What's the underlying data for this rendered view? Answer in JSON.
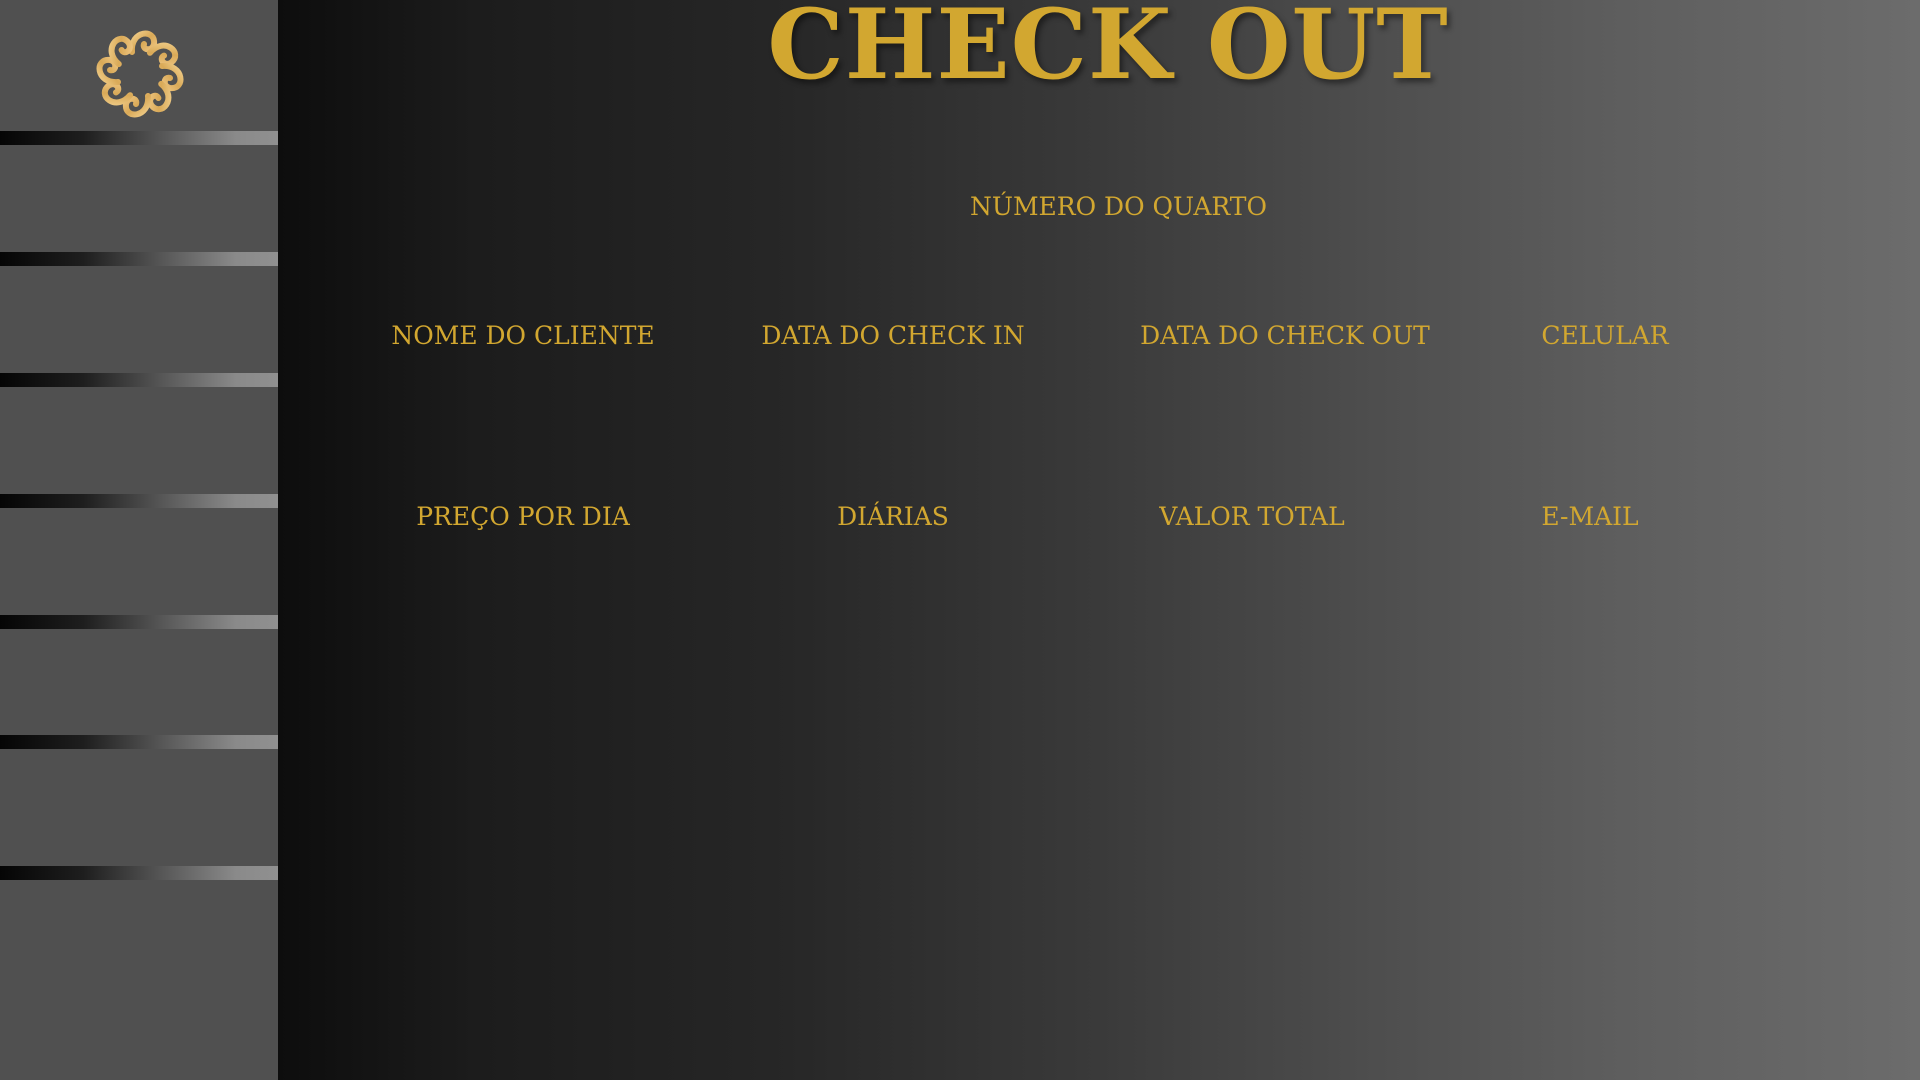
{
  "page": {
    "title": "CHECK OUT"
  },
  "colors": {
    "accent_gold": "#d2a730",
    "sidebar_bg": "#505050",
    "logo_gold": "#e3b96d"
  },
  "sidebar": {
    "logo_icon": "ornament-logo-icon",
    "items": [
      {
        "label": ""
      },
      {
        "label": ""
      },
      {
        "label": ""
      },
      {
        "label": ""
      },
      {
        "label": ""
      },
      {
        "label": ""
      },
      {
        "label": ""
      }
    ]
  },
  "form": {
    "room_number_label": "NÚMERO DO QUARTO",
    "client_name_label": "NOME DO CLIENTE",
    "checkin_date_label": "DATA DO CHECK IN",
    "checkout_date_label": "DATA DO CHECK OUT",
    "phone_label": "CELULAR",
    "price_per_day_label": "PREÇO POR DIA",
    "days_label": "DIÁRIAS",
    "total_value_label": "VALOR TOTAL",
    "email_label": "E-MAIL"
  }
}
